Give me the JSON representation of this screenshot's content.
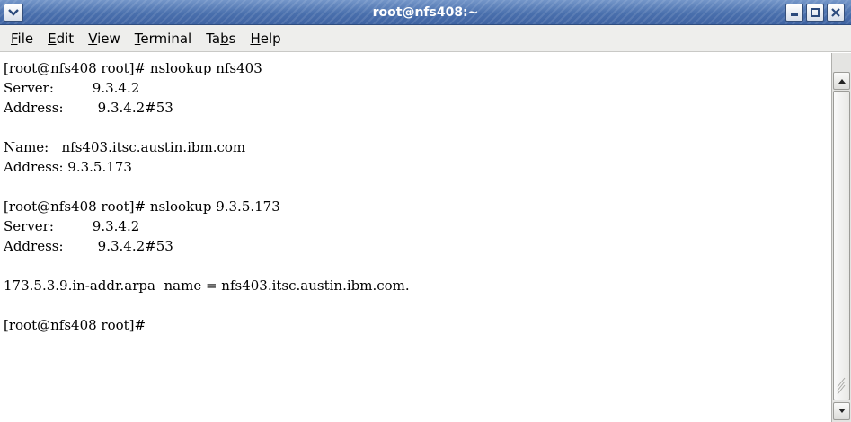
{
  "window": {
    "title": "root@nfs408:~"
  },
  "menubar": {
    "items": [
      {
        "label_u": "F",
        "label_rest": "ile"
      },
      {
        "label_u": "E",
        "label_rest": "dit"
      },
      {
        "label_u": "V",
        "label_rest": "iew"
      },
      {
        "label_u": "T",
        "label_rest": "erminal"
      },
      {
        "label_pre": "Ta",
        "label_u": "b",
        "label_rest": "s"
      },
      {
        "label_u": "H",
        "label_rest": "elp"
      }
    ]
  },
  "terminal": {
    "lines": [
      "[root@nfs408 root]# nslookup nfs403",
      "Server:         9.3.4.2",
      "Address:        9.3.4.2#53",
      "",
      "Name:   nfs403.itsc.austin.ibm.com",
      "Address: 9.3.5.173",
      "",
      "[root@nfs408 root]# nslookup 9.3.5.173",
      "Server:         9.3.4.2",
      "Address:        9.3.4.2#53",
      "",
      "173.5.3.9.in-addr.arpa  name = nfs403.itsc.austin.ibm.com.",
      "",
      "[root@nfs408 root]#"
    ]
  },
  "icons": {
    "window_menu": "chevron-down-icon",
    "minimize": "minimize-icon",
    "maximize": "maximize-icon",
    "close": "close-icon",
    "scroll_up": "arrow-up-icon",
    "scroll_down": "arrow-down-icon"
  },
  "colors": {
    "titlebar": "#4a70ad",
    "menubar": "#eeeeec",
    "terminal_bg": "#ffffff",
    "terminal_fg": "#000000"
  }
}
